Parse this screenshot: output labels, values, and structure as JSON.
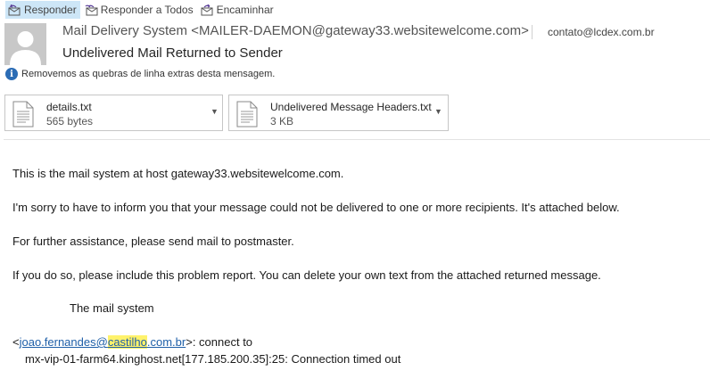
{
  "toolbar": {
    "reply": "Responder",
    "reply_all": "Responder a Todos",
    "forward": "Encaminhar"
  },
  "header": {
    "from": "Mail Delivery System <MAILER-DAEMON@gateway33.websitewelcome.com>",
    "to": "contato@lcdex.com.br",
    "subject": "Undelivered Mail Returned to Sender"
  },
  "info_bar": {
    "text": "Removemos as quebras de linha extras desta mensagem."
  },
  "attachments": [
    {
      "name": "details.txt",
      "size": "565 bytes"
    },
    {
      "name": "Undelivered Message Headers.txt",
      "size": "3 KB"
    }
  ],
  "body": {
    "p1": "This is the mail system at host gateway33.websitewelcome.com.",
    "p2": "I'm sorry to have to inform you that your message could not be delivered to one or more recipients. It's attached below.",
    "p3": "For further assistance, please send mail to postmaster.",
    "p4": "If you do so, please include this problem report. You can delete your own text from the attached returned message.",
    "signature": "The mail system",
    "recipient_open": "<",
    "recipient_user": "joao.fernandes@",
    "recipient_domain_hl": "castilho",
    "recipient_domain_rest": ".com.br",
    "recipient_close": ">: connect to",
    "error_line": "mx-vip-01-farm64.kinghost.net[177.185.200.35]:25: Connection timed out"
  },
  "colors": {
    "accent": "#2b6cb5",
    "link": "#1f5fa8",
    "highlight": "#fff26b",
    "active_button": "#cde6f7"
  }
}
